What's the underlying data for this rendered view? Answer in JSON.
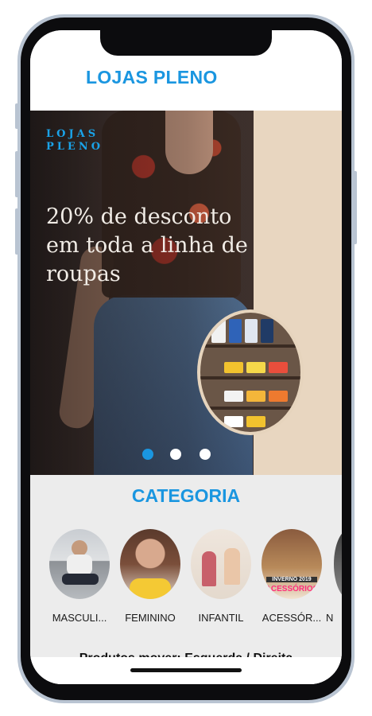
{
  "app": {
    "title": "LOJAS PLENO"
  },
  "banner": {
    "brand_line1": "LOJAS",
    "brand_line2": "PLENO",
    "promo_text": "20% de desconto em toda a linha de roupas",
    "slides_total": 3,
    "active_slide": 1
  },
  "categories": {
    "heading": "CATEGORIA",
    "items": [
      {
        "label": "MASCULI..."
      },
      {
        "label": "FEMININO"
      },
      {
        "label": "INFANTIL"
      },
      {
        "label": "ACESSÓR..."
      },
      {
        "label": "N"
      }
    ],
    "accessory_image_text_1": "INVERNO 2019",
    "accessory_image_text_2": "ACESSÓRIOS"
  },
  "products": {
    "hint": "Produtos mover: Esquerda / Direita"
  },
  "colors": {
    "accent": "#1a96e0",
    "category_bg": "#ececec",
    "promo_text": "#f1ece6"
  }
}
